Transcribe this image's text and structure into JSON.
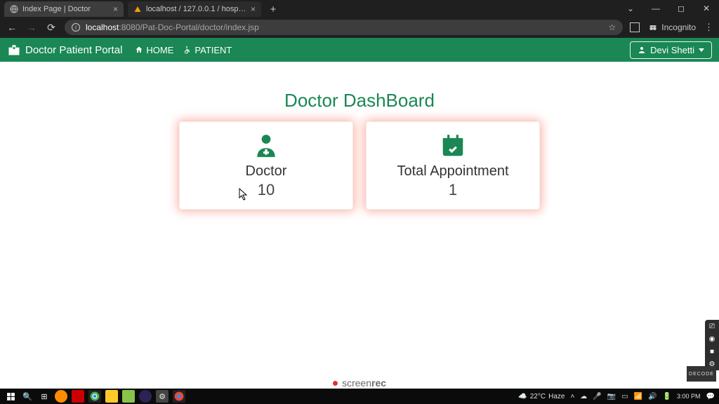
{
  "browser": {
    "tabs": [
      {
        "title": "Index Page | Doctor",
        "favicon": "globe-icon",
        "active": true
      },
      {
        "title": "localhost / 127.0.0.1 / hospital / d",
        "favicon": "phpmyadmin-icon",
        "active": false
      }
    ],
    "url_host": "localhost",
    "url_port": ":8080",
    "url_path": "/Pat-Doc-Portal/doctor/index.jsp",
    "incognito_label": "Incognito"
  },
  "navbar": {
    "brand": "Doctor Patient Portal",
    "links": {
      "home": "HOME",
      "patient": "PATIENT"
    },
    "user_name": "Devi Shetti"
  },
  "dashboard": {
    "title": "Doctor DashBoard",
    "cards": [
      {
        "icon": "doctor-icon",
        "label": "Doctor",
        "value": "10"
      },
      {
        "icon": "calendar-check-icon",
        "label": "Total Appointment",
        "value": "1"
      }
    ]
  },
  "screenrec": {
    "label_light": "screen",
    "label_bold": "rec"
  },
  "decode_badge": "DECODE",
  "taskbar": {
    "weather_temp": "22°C",
    "weather_desc": "Haze",
    "time": "3:00 PM"
  }
}
